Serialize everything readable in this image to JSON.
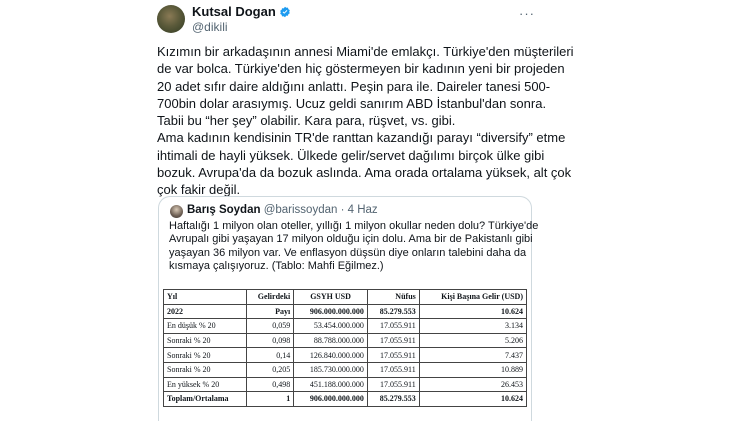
{
  "tweet": {
    "author_name": "Kutsal Dogan",
    "author_handle": "@dikili",
    "more_label": "···",
    "lines": [
      "Kızımın bir arkadaşının annesi Miami'de emlakçı. Türkiye'den müşterileri",
      "de var bolca. Türkiye'den hiç göstermeyen bir kadının yeni bir projeden",
      "20 adet sıfır daire aldığını anlattı. Peşin para ile. Daireler tanesi 500-",
      "700bin dolar arasıymış. Ucuz geldi sanırım ABD İstanbul'dan sonra.",
      "Tabii bu “her şey” olabilir. Kara para, rüşvet, vs. gibi.",
      "Ama kadının kendisinin TR'de ranttan kazandığı parayı “diversify” etme",
      "ihtimali de hayli yüksek. Ülkede gelir/servet dağılımı birçok ülke gibi",
      "bozuk. Avrupa'da da bozuk aslında. Ama orada ortalama yüksek, alt çok",
      "çok fakir değil."
    ]
  },
  "quote": {
    "author_name": "Barış Soydan",
    "author_handle": "@barissoydan",
    "separator": "·",
    "date": "4 Haz",
    "lines": [
      "Haftalığı 1 milyon olan oteller, yıllığı 1 milyon okullar neden dolu? Türkiye'de",
      "Avrupalı gibi yaşayan 17 milyon olduğu için dolu. Ama bir de Pakistanlı gibi",
      "yaşayan 36 milyon var. Ve enflasyon düşsün diye onların talebini daha da",
      "kısmaya çalışıyoruz. (Tablo: Mahfi Eğilmez.)"
    ]
  },
  "table": {
    "headers": [
      "Yıl",
      "Gelirdeki",
      "GSYH USD",
      "Nüfus",
      "Kişi Başına Gelir (USD)"
    ],
    "subheaders": [
      "2022",
      "Payı",
      "906.000.000.000",
      "85.279.553",
      "10.624"
    ],
    "rows": [
      [
        "En düşük % 20",
        "0,059",
        "53.454.000.000",
        "17.055.911",
        "3.134"
      ],
      [
        "Sonraki % 20",
        "0,098",
        "88.788.000.000",
        "17.055.911",
        "5.206"
      ],
      [
        "Sonraki % 20",
        "0,14",
        "126.840.000.000",
        "17.055.911",
        "7.437"
      ],
      [
        "Sonraki % 20",
        "0,205",
        "185.730.000.000",
        "17.055.911",
        "10.889"
      ],
      [
        "En yüksek % 20",
        "0,498",
        "451.188.000.000",
        "17.055.911",
        "26.453"
      ]
    ],
    "total": [
      "Toplam/Ortalama",
      "1",
      "906.000.000.000",
      "85.279.553",
      "10.624"
    ]
  },
  "colors": {
    "verified": "#1d9bf0",
    "secondary_text": "#536471",
    "border": "#cfd9de"
  }
}
